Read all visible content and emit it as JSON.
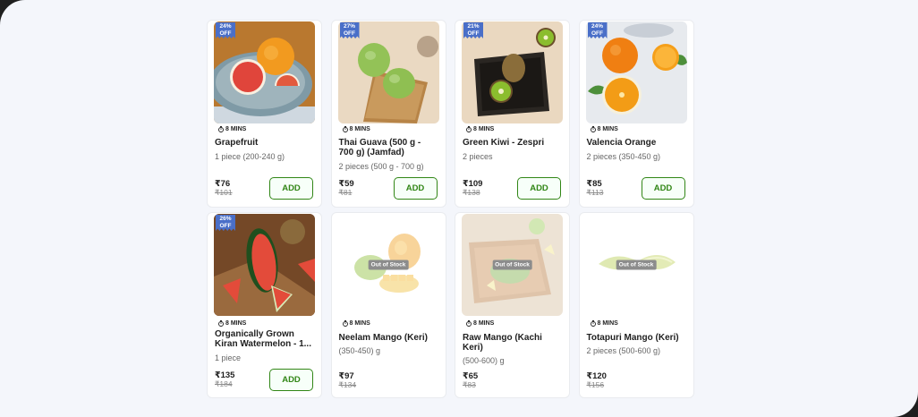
{
  "products": [
    {
      "discount_pct": "24%",
      "discount_off": "OFF",
      "eta": "8 MINS",
      "name": "Grapefruit",
      "quantity": "1 piece (200-240 g)",
      "price": "₹76",
      "mrp": "₹101",
      "add_label": "ADD",
      "image": "grapefruit"
    },
    {
      "discount_pct": "27%",
      "discount_off": "OFF",
      "eta": "8 MINS",
      "name": "Thai Guava (500 g - 700 g) (Jamfad)",
      "quantity": "2 pieces (500 g - 700 g)",
      "price": "₹59",
      "mrp": "₹81",
      "add_label": "ADD",
      "image": "guava"
    },
    {
      "discount_pct": "21%",
      "discount_off": "OFF",
      "eta": "8 MINS",
      "name": "Green Kiwi - Zespri",
      "quantity": "2 pieces",
      "price": "₹109",
      "mrp": "₹138",
      "add_label": "ADD",
      "image": "kiwi"
    },
    {
      "discount_pct": "24%",
      "discount_off": "OFF",
      "eta": "8 MINS",
      "name": "Valencia Orange",
      "quantity": "2 pieces (350-450 g)",
      "price": "₹85",
      "mrp": "₹113",
      "add_label": "ADD",
      "image": "orange"
    },
    {
      "discount_pct": "26%",
      "discount_off": "OFF",
      "eta": "8 MINS",
      "name": "Organically Grown Kiran Watermelon - 1...",
      "quantity": "1 piece",
      "price": "₹135",
      "mrp": "₹184",
      "add_label": "ADD",
      "image": "watermelon"
    },
    {
      "out_of_stock": "Out of Stock",
      "eta": "8 MINS",
      "name": "Neelam Mango (Keri)",
      "quantity": "(350-450) g",
      "price": "₹97",
      "mrp": "₹134",
      "image": "neelam-mango"
    },
    {
      "out_of_stock": "Out of Stock",
      "eta": "8 MINS",
      "name": "Raw Mango (Kachi Keri)",
      "quantity": "(500-600) g",
      "price": "₹65",
      "mrp": "₹83",
      "image": "raw-mango"
    },
    {
      "out_of_stock": "Out of Stock",
      "eta": "8 MINS",
      "name": "Totapuri Mango (Keri)",
      "quantity": "2 pieces (500-600 g)",
      "price": "₹120",
      "mrp": "₹156",
      "image": "totapuri-mango"
    }
  ],
  "colors": {
    "discount_badge": "#4a6fc8",
    "add_button": "#318616",
    "page_bg": "#f4f6fb",
    "frame_bg": "#1f1f1f"
  }
}
